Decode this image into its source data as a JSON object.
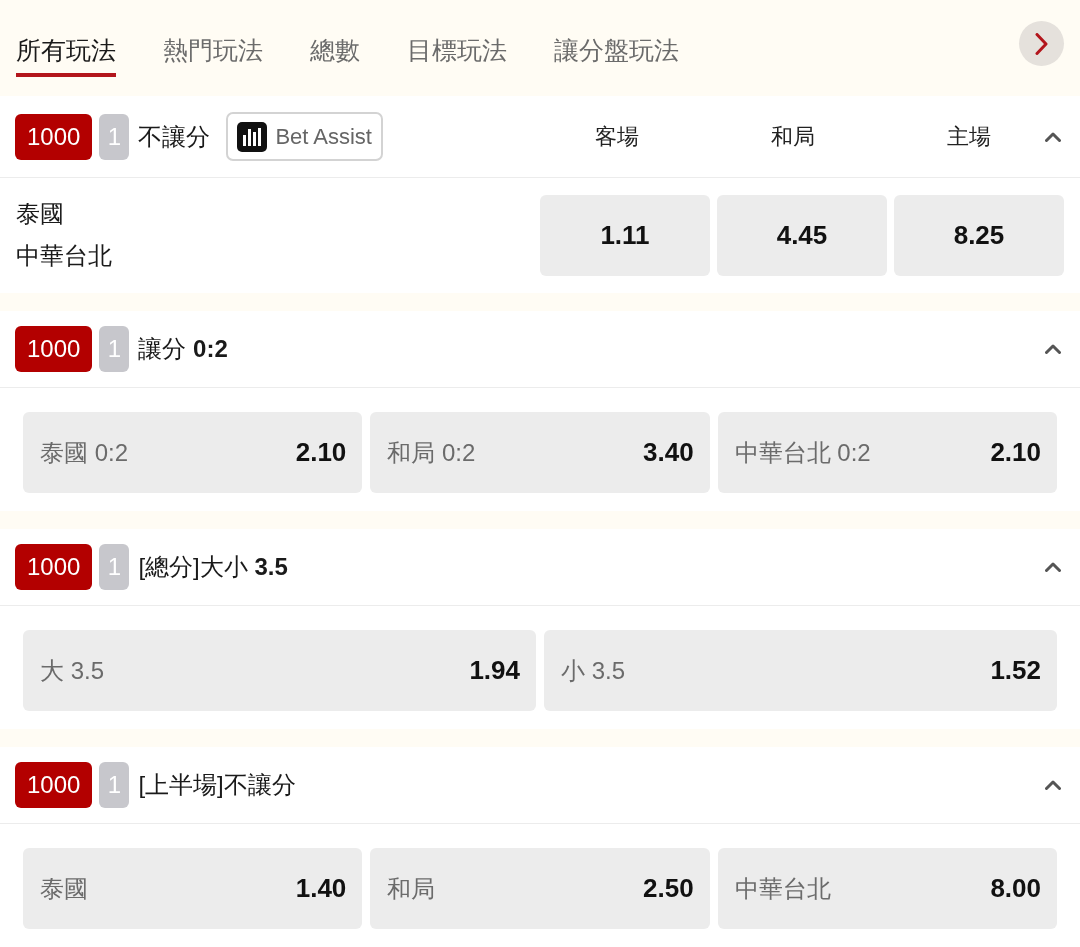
{
  "tabs": [
    {
      "label": "所有玩法",
      "selected": true
    },
    {
      "label": "熱門玩法",
      "selected": false
    },
    {
      "label": "總數",
      "selected": false
    },
    {
      "label": "目標玩法",
      "selected": false
    },
    {
      "label": "讓分盤玩法",
      "selected": false
    }
  ],
  "markets": [
    {
      "kind": "match",
      "code": "1000",
      "count": "1",
      "title": "不讓分",
      "assist_button": "Bet Assist",
      "expanded": true,
      "columns": [
        "客場",
        "和局",
        "主場"
      ],
      "teams": [
        "泰國",
        "中華台北"
      ],
      "odds": [
        "1.11",
        "4.45",
        "8.25"
      ]
    },
    {
      "kind": "list",
      "code": "1000",
      "count": "1",
      "title": "讓分 **0:2**",
      "expanded": true,
      "selections": [
        {
          "label": "泰國 0:2",
          "odds": "2.10"
        },
        {
          "label": "和局 0:2",
          "odds": "3.40"
        },
        {
          "label": "中華台北 0:2",
          "odds": "2.10"
        }
      ]
    },
    {
      "kind": "list",
      "code": "1000",
      "count": "1",
      "title": "[總分]大小 **3.5**",
      "expanded": true,
      "selections": [
        {
          "label": "大 3.5",
          "odds": "1.94"
        },
        {
          "label": "小 3.5",
          "odds": "1.52"
        }
      ]
    },
    {
      "kind": "list",
      "code": "1000",
      "count": "1",
      "title": "[上半場]不讓分",
      "expanded": true,
      "selections": [
        {
          "label": "泰國",
          "odds": "1.40"
        },
        {
          "label": "和局",
          "odds": "2.50"
        },
        {
          "label": "中華台北",
          "odds": "8.00"
        }
      ]
    }
  ]
}
